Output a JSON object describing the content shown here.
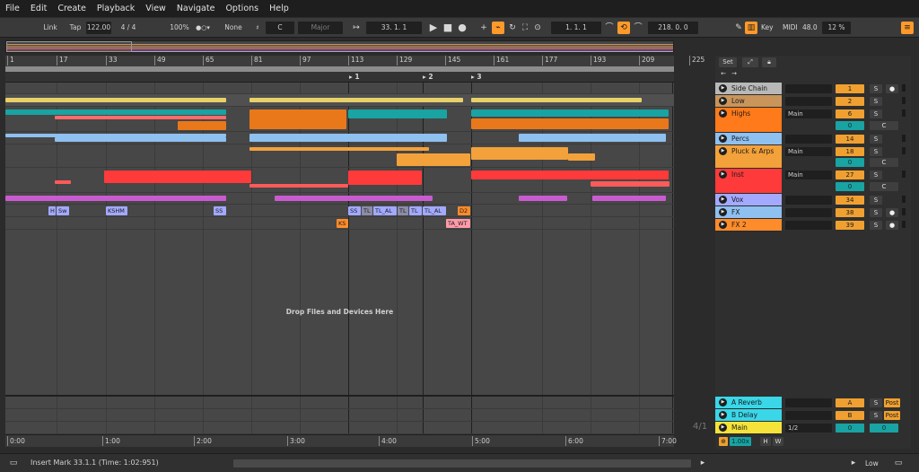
{
  "menu": [
    "File",
    "Edit",
    "Create",
    "Playback",
    "View",
    "Navigate",
    "Options",
    "Help"
  ],
  "transport": {
    "link": "Link",
    "tap": "Tap",
    "tempo": "122.00",
    "signature": "4 / 4",
    "zoom": "100%",
    "metronome": "1 Bar",
    "quantize": "None",
    "scale_root": "C",
    "scale_mode": "Major",
    "position": "33.  1.  1",
    "loop_start": "1.  1.  1",
    "loop_length": "218.  0.  0",
    "key": "Key",
    "midi": "MIDI",
    "cpu_value": "48.0",
    "cpu_load": "12 %"
  },
  "ruler": {
    "bars": [
      "1",
      "17",
      "33",
      "49",
      "65",
      "81",
      "97",
      "113",
      "129",
      "145",
      "161",
      "177",
      "193",
      "209",
      "225"
    ],
    "locators": [
      "1",
      "2",
      "3"
    ]
  },
  "arrangement": {
    "drop_hint": "Drop Files and Devices Here",
    "clip_labels": [
      "H",
      "Sw",
      "KSHM",
      "SS",
      "SS",
      "TL",
      "TL_AL",
      "TL",
      "TL",
      "TL_AL",
      "D2",
      "KS",
      "TA_WT"
    ],
    "zoom_label": "4/1"
  },
  "time_ruler": [
    "0:00",
    "1:00",
    "2:00",
    "3:00",
    "4:00",
    "5:00",
    "6:00",
    "7:00"
  ],
  "mixer": {
    "set_label": "Set",
    "tracks": [
      {
        "name": "Side Chain",
        "color": "#b8b8b8",
        "number": "1",
        "input": ""
      },
      {
        "name": "Low",
        "color": "#c9955b",
        "number": "2",
        "input": ""
      },
      {
        "name": "Highs",
        "color": "#ff7a1a",
        "number": "6",
        "input": "Main",
        "sub": "0",
        "cue": "C"
      },
      {
        "name": "Percs",
        "color": "#8ec0f0",
        "number": "14",
        "input": ""
      },
      {
        "name": "Pluck & Arps",
        "color": "#f3a13a",
        "number": "18",
        "input": "Main",
        "sub": "0",
        "cue": "C"
      },
      {
        "name": "Inst",
        "color": "#ff3a3a",
        "number": "27",
        "input": "Main",
        "sub": "0",
        "cue": "C"
      },
      {
        "name": "Vox",
        "color": "#a3a9ff",
        "number": "34",
        "input": ""
      },
      {
        "name": "FX",
        "color": "#8ec0f0",
        "number": "38",
        "input": ""
      },
      {
        "name": "FX 2",
        "color": "#ff8c2a",
        "number": "39",
        "input": ""
      }
    ],
    "returns": [
      {
        "name": "A Reverb",
        "color": "#39d7e8",
        "letter": "A",
        "post": "Post"
      },
      {
        "name": "B Delay",
        "color": "#39d7e8",
        "letter": "B",
        "post": "Post"
      },
      {
        "name": "Main",
        "color": "#f5e33a",
        "routing": "1/2",
        "vol": "0",
        "pan": "0"
      }
    ],
    "crossfade": "1.00x",
    "h_label": "H",
    "w_label": "W",
    "solo_label": "S"
  },
  "status": {
    "message": "Insert Mark 33.1.1 (Time: 1:02:951)",
    "track": "Low"
  }
}
